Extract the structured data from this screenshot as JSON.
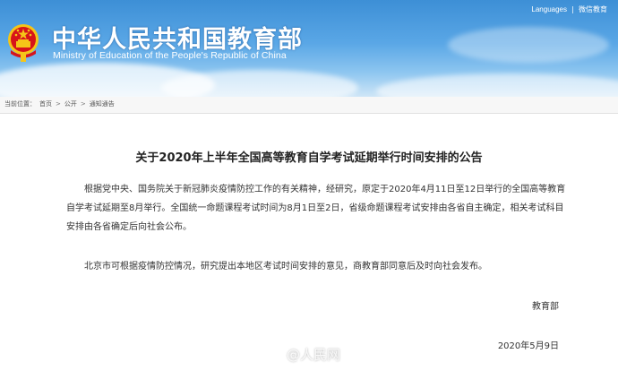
{
  "header": {
    "title_cn": "中华人民共和国教育部",
    "title_en": "Ministry of Education of the People's Republic of China",
    "links": [
      "Languages",
      "微信教育"
    ]
  },
  "breadcrumb": {
    "label": "当前位置：",
    "items": [
      "首页",
      "公开",
      "通知通告"
    ],
    "separator": ">"
  },
  "document": {
    "title": "关于2020年上半年全国高等教育自学考试延期举行时间安排的公告",
    "paragraphs": [
      "根据党中央、国务院关于新冠肺炎疫情防控工作的有关精神，经研究，原定于2020年4月11日至12日举行的全国高等教育自学考试延期至8月举行。全国统一命题课程考试时间为8月1日至2日，省级命题课程考试安排由各省自主确定，相关考试科目安排由各省确定后向社会公布。",
      "北京市可根据疫情防控情况，研究提出本地区考试时间安排的意见，商教育部同意后及时向社会发布。"
    ],
    "signature": "教育部",
    "date": "2020年5月9日"
  },
  "watermark": {
    "text": "@人民网"
  },
  "colors": {
    "header_top": "#3d8fd6",
    "header_bottom": "#cfe6f7",
    "emblem_red": "#d7141a",
    "emblem_gold": "#f5c518"
  }
}
